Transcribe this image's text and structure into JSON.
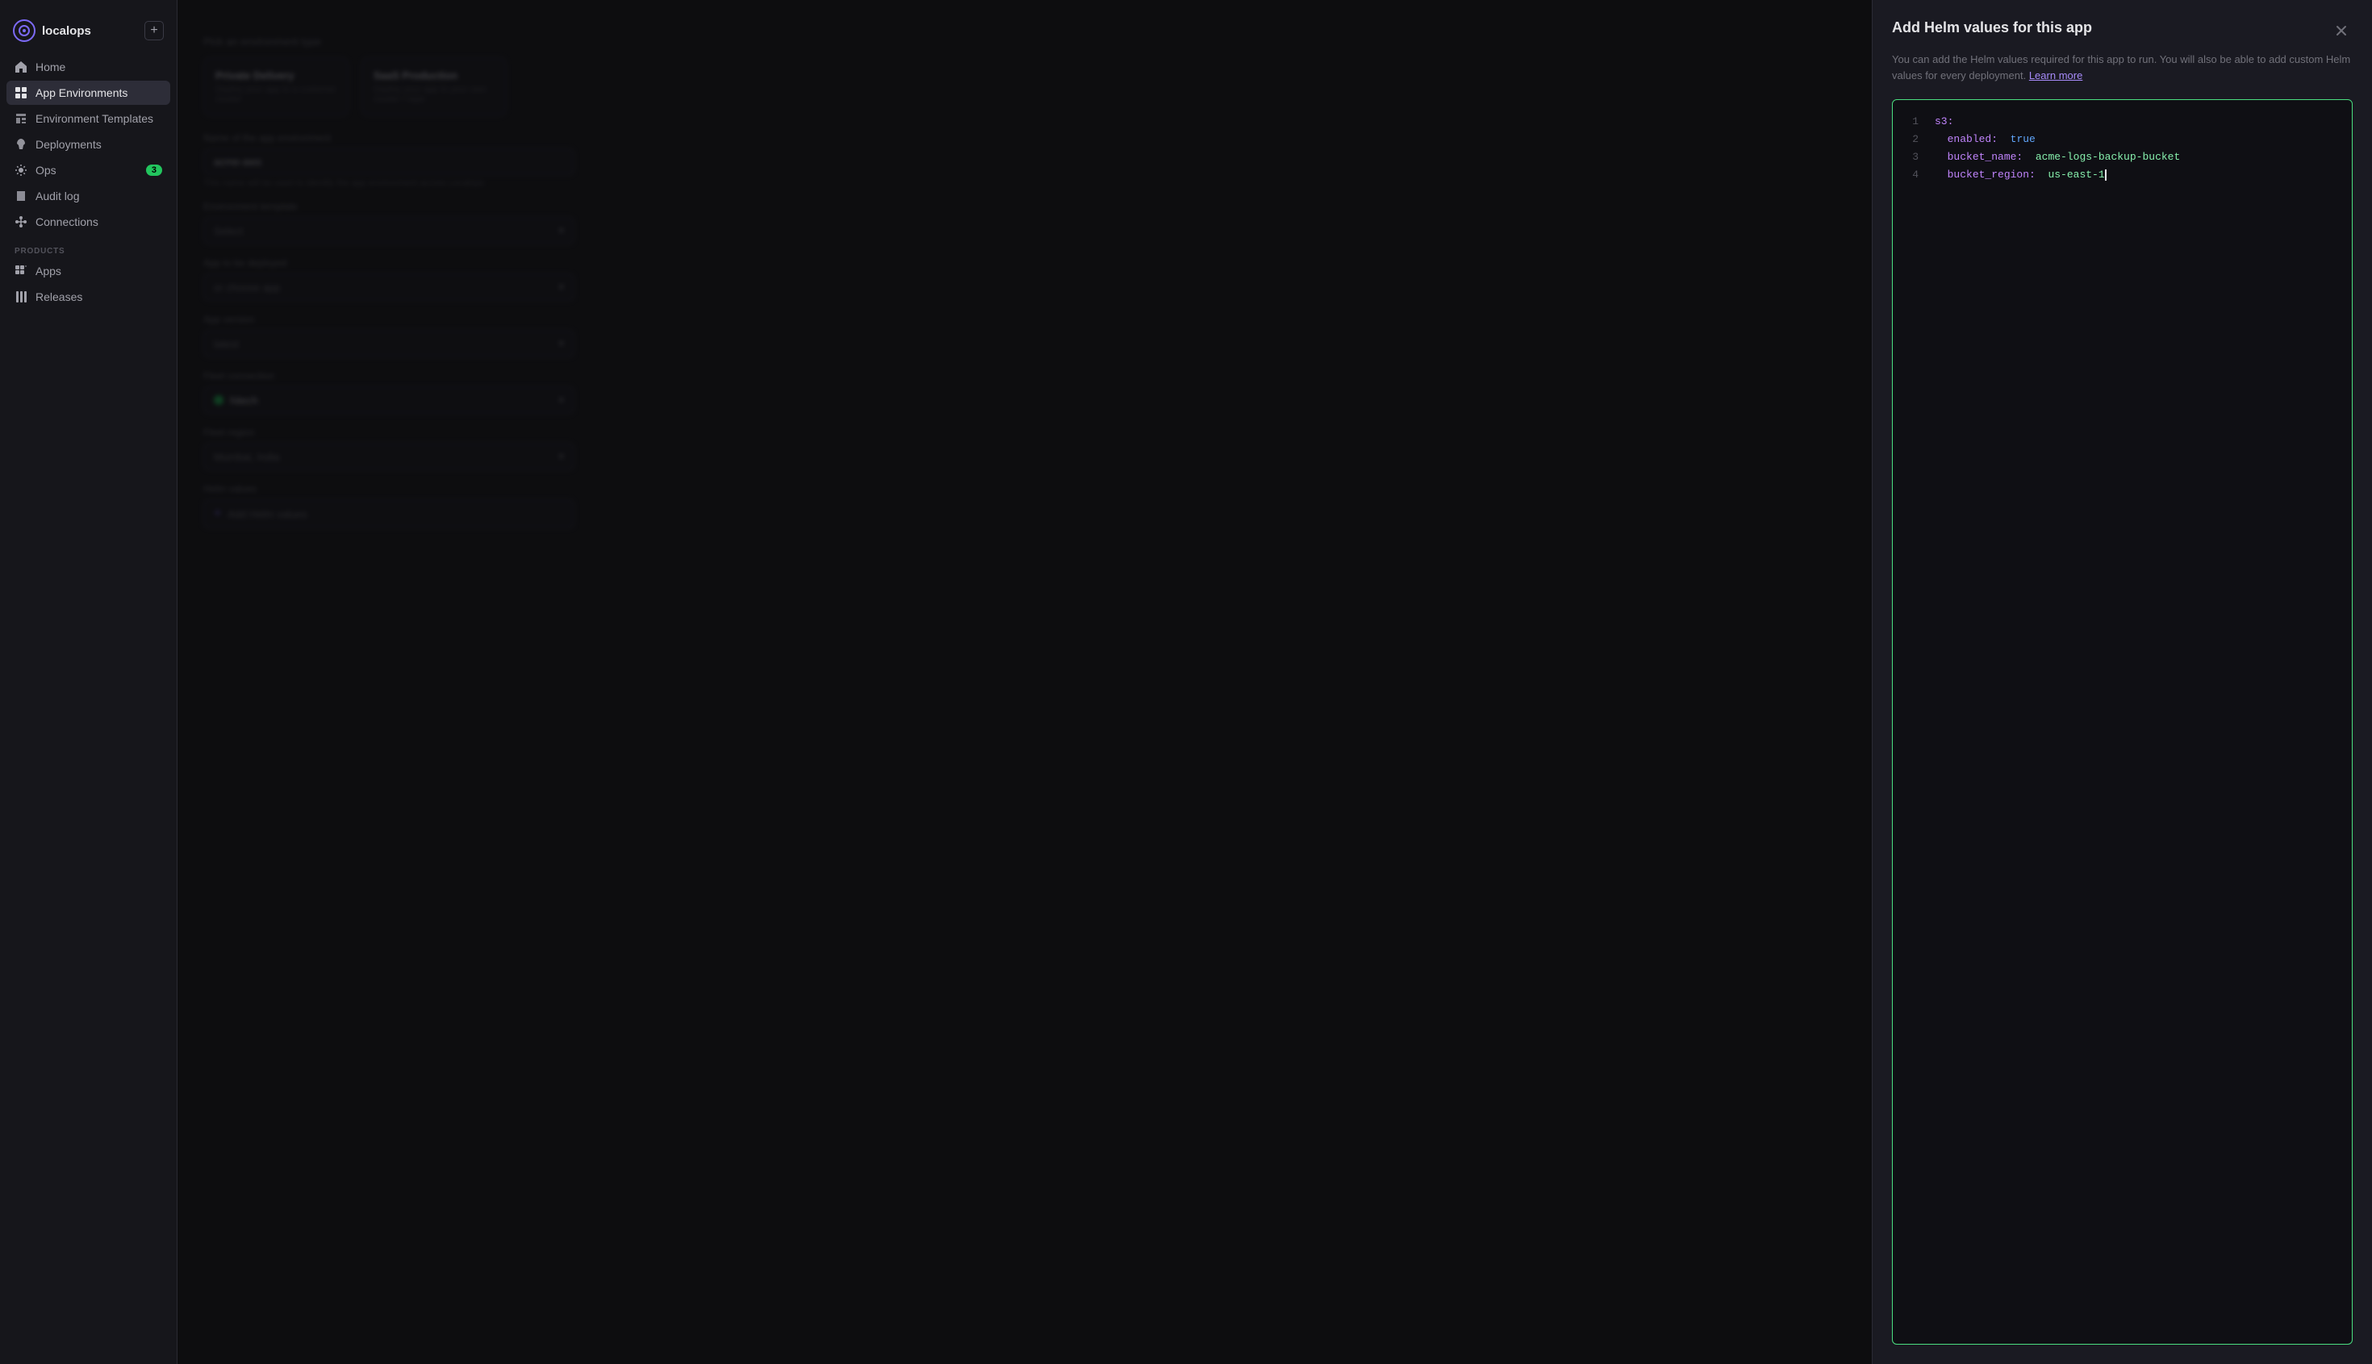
{
  "app": {
    "name": "localops",
    "add_button_label": "+"
  },
  "sidebar": {
    "logo_text": "localops",
    "nav_items": [
      {
        "id": "home",
        "label": "Home",
        "icon": "home-icon",
        "active": false,
        "badge": null
      },
      {
        "id": "app-environments",
        "label": "App Environments",
        "icon": "grid-icon",
        "active": true,
        "badge": null
      },
      {
        "id": "environment-templates",
        "label": "Environment Templates",
        "icon": "template-icon",
        "active": false,
        "badge": null
      },
      {
        "id": "deployments",
        "label": "Deployments",
        "icon": "rocket-icon",
        "active": false,
        "badge": null
      },
      {
        "id": "ops",
        "label": "Ops",
        "icon": "ops-icon",
        "active": false,
        "badge": "3"
      },
      {
        "id": "audit-log",
        "label": "Audit log",
        "icon": "audit-icon",
        "active": false,
        "badge": null
      },
      {
        "id": "connections",
        "label": "Connections",
        "icon": "connections-icon",
        "active": false,
        "badge": null
      }
    ],
    "products_section_label": "PRODUCTS",
    "products_items": [
      {
        "id": "apps",
        "label": "Apps",
        "icon": "apps-icon",
        "active": false
      },
      {
        "id": "releases",
        "label": "Releases",
        "icon": "releases-icon",
        "active": false
      }
    ]
  },
  "form": {
    "env_type_label": "Pick an environment type",
    "env_cards": [
      {
        "title": "Private Delivery",
        "desc": "Deploy your app to a customer cluster"
      },
      {
        "title": "SaaS Production",
        "desc": "Deploy your app to your own cluster / repo"
      }
    ],
    "name_section": {
      "label": "Name of the app environment",
      "input_placeholder": "acme-aws",
      "hint": "This name will be used to identify the app environment across Localops"
    },
    "env_template_label": "Environment template",
    "app_deployed_label": "App to be deployed",
    "app_version_label": "App version",
    "fleet_connection_label": "Fleet connection",
    "fleet_region_label": "Fleet region",
    "helm_values_label": "Helm values"
  },
  "modal": {
    "title": "Add Helm values for this app",
    "description": "You can add the Helm values required for this app to run. You will also be able to add custom Helm values for every deployment.",
    "learn_more_label": "Learn more",
    "close_icon": "close-icon",
    "code_lines": [
      {
        "number": "1",
        "content": "s3:",
        "type": "key-only"
      },
      {
        "number": "2",
        "content": "  enabled: true",
        "type": "key-bool",
        "key": "enabled",
        "value": "true"
      },
      {
        "number": "3",
        "content": "  bucket_name: acme-logs-backup-bucket",
        "type": "key-string",
        "key": "bucket_name",
        "value": "acme-logs-backup-bucket"
      },
      {
        "number": "4",
        "content": "  bucket_region: us-east-1",
        "type": "key-string-cursor",
        "key": "bucket_region",
        "value": "us-east-1"
      }
    ]
  }
}
